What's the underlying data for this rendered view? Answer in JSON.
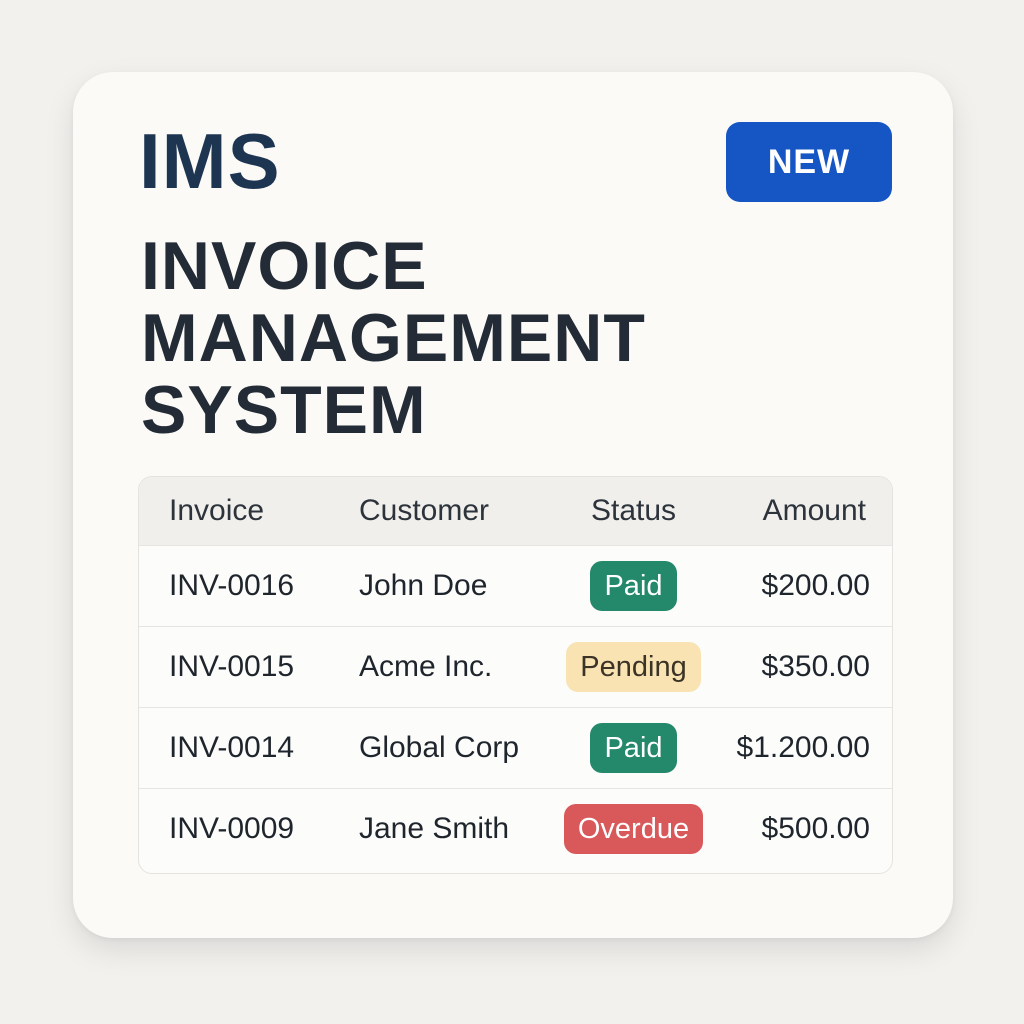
{
  "header": {
    "brand": "IMS",
    "new_button_label": "NEW",
    "title_lines": [
      "INVOICE",
      "MANAGEMENT",
      "SYSTEM"
    ]
  },
  "table": {
    "columns": [
      "Invoice",
      "Customer",
      "Status",
      "Amount"
    ],
    "rows": [
      {
        "invoice": "INV-0016",
        "customer": "John Doe",
        "status": "Paid",
        "status_type": "paid",
        "amount": "$200.00"
      },
      {
        "invoice": "INV-0015",
        "customer": "Acme Inc.",
        "status": "Pending",
        "status_type": "pending",
        "amount": "$350.00"
      },
      {
        "invoice": "INV-0014",
        "customer": "Global Corp",
        "status": "Paid",
        "status_type": "paid",
        "amount": "$1.200.00"
      },
      {
        "invoice": "INV-0009",
        "customer": "Jane Smith",
        "status": "Overdue",
        "status_type": "overdue",
        "amount": "$500.00"
      }
    ]
  },
  "colors": {
    "accent": "#1656c4",
    "paid": "#24886b",
    "pending": "#f9e3b3",
    "overdue": "#d9595a"
  }
}
